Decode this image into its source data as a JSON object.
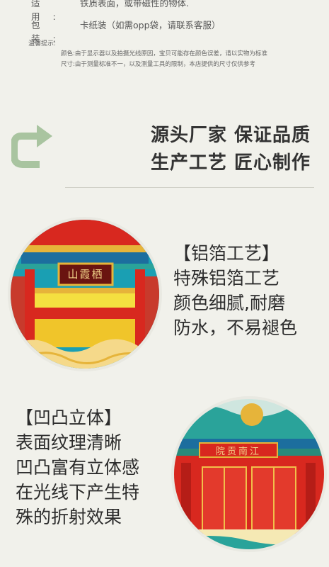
{
  "specs": {
    "use_key": "适用:",
    "use_value": "铁质表面，或带磁性的物体.",
    "pack_key": "包装:",
    "pack_value": "卡纸装（如需opp袋，请联系客服）"
  },
  "tips": {
    "title": "温馨提示:",
    "color_note": "颜色:由于显示器以及拍摄光线原因，宝贝可能存在颜色误差，请以实物为标准",
    "size_note": "尺寸:由于测量标准不一，以及测量工具的限制，本店提供的尺寸仅供参考"
  },
  "slogan": {
    "line1": "源头厂家 保证品质",
    "line2": "生产工艺 匠心制作"
  },
  "feature1": {
    "title": "【铝箔工艺】",
    "line1": "特殊铝箔工艺",
    "line2": "颜色细腻,耐磨",
    "line3": "防水，不易褪色",
    "plaque_text": "山霞栖"
  },
  "feature2": {
    "title": "【凹凸立体】",
    "line1": "表面纹理清晰",
    "line2": "凹凸富有立体感",
    "line3": "在光线下产生特",
    "line4": "殊的折射效果",
    "plaque_text": "院贡南江"
  },
  "colors": {
    "background": "#f1f1eb",
    "arrow": "#a9c4a0",
    "red": "#d8281f",
    "gold": "#e6b43a",
    "teal": "#2aa39a"
  },
  "icons": {
    "arrow": "u-turn-arrow-icon"
  }
}
